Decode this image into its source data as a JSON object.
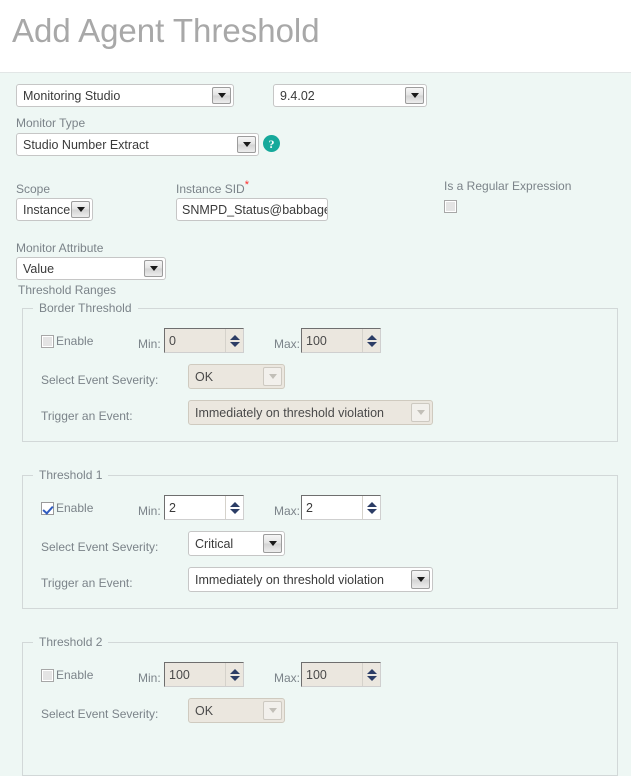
{
  "header": {
    "title": "Add Agent Threshold"
  },
  "top_selectors": {
    "product": {
      "value": "Monitoring Studio",
      "icon": "chevron-down-icon"
    },
    "version": {
      "value": "9.4.02",
      "icon": "chevron-down-icon"
    }
  },
  "monitor_type": {
    "label": "Monitor Type",
    "value": "Studio Number Extract",
    "help_icon": "help-question-icon",
    "help_glyph": "?"
  },
  "scope": {
    "label": "Scope",
    "value": "Instance"
  },
  "instance_sid": {
    "label": "Instance SID",
    "required_marker": "*",
    "value": "SNMPD_Status@babbage",
    "placeholder": ""
  },
  "regex": {
    "label": "Is a Regular Expression",
    "checked": false
  },
  "monitor_attribute": {
    "label": "Monitor Attribute",
    "value": "Value"
  },
  "threshold_ranges": {
    "section_label": "Threshold Ranges",
    "labels": {
      "enable": "Enable",
      "min": "Min:",
      "max": "Max:",
      "severity": "Select Event Severity:",
      "trigger": "Trigger an Event:"
    },
    "groups": [
      {
        "title": "Border Threshold",
        "enabled": false,
        "min": "0",
        "max": "100",
        "severity": "OK",
        "trigger": "Immediately on threshold violation"
      },
      {
        "title": "Threshold 1",
        "enabled": true,
        "min": "2",
        "max": "2",
        "severity": "Critical",
        "trigger": "Immediately on threshold violation"
      },
      {
        "title": "Threshold 2",
        "enabled": false,
        "min": "100",
        "max": "100",
        "severity": "OK",
        "trigger": ""
      }
    ]
  },
  "colors": {
    "accent_teal": "#16a99b",
    "body_background": "#eef7f4",
    "header_background": "#ffffff",
    "title_gray": "#a8a8a8",
    "label_gray": "#7b8389",
    "required_red": "#ff2a2a",
    "disabled_field": "#ebe7df"
  }
}
